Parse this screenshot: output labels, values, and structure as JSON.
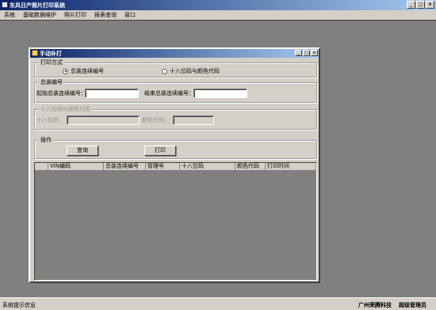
{
  "app": {
    "title": "东风日产照片打印系统",
    "window_buttons": {
      "minimize": "_",
      "maximize": "□",
      "close": "×"
    }
  },
  "menu": {
    "items": [
      "系统",
      "基础数据维护",
      "照片打印",
      "报表查询",
      "窗口"
    ]
  },
  "child_window": {
    "title": "手动补打",
    "window_buttons": {
      "minimize": "_",
      "maximize": "□",
      "close": "×"
    },
    "print_mode": {
      "legend": "打印方式",
      "options": [
        {
          "label": "总装连续编号",
          "selected": true
        },
        {
          "label": "十八位码与颜色代码",
          "selected": false
        }
      ]
    },
    "assembly_number": {
      "legend": "总装编号",
      "start_label": "起始总装连续编号：",
      "start_value": "",
      "end_label": "结束总装连续编号：",
      "end_value": ""
    },
    "code_color": {
      "legend": "十八位码与颜色代码",
      "code_label": "十八位码：",
      "code_value": "",
      "color_label": "颜色代码：",
      "color_value": ""
    },
    "operations": {
      "legend": "操作",
      "query_button": "查询",
      "print_button": "打印"
    },
    "grid": {
      "columns": [
        "VIN编码",
        "总装连续编号",
        "管理号",
        "十八位码",
        "颜色代码",
        "打印时间"
      ]
    }
  },
  "status_bar": {
    "message": "系统提示信息",
    "company": "广州荣腾科技",
    "user": "超级管理员"
  }
}
